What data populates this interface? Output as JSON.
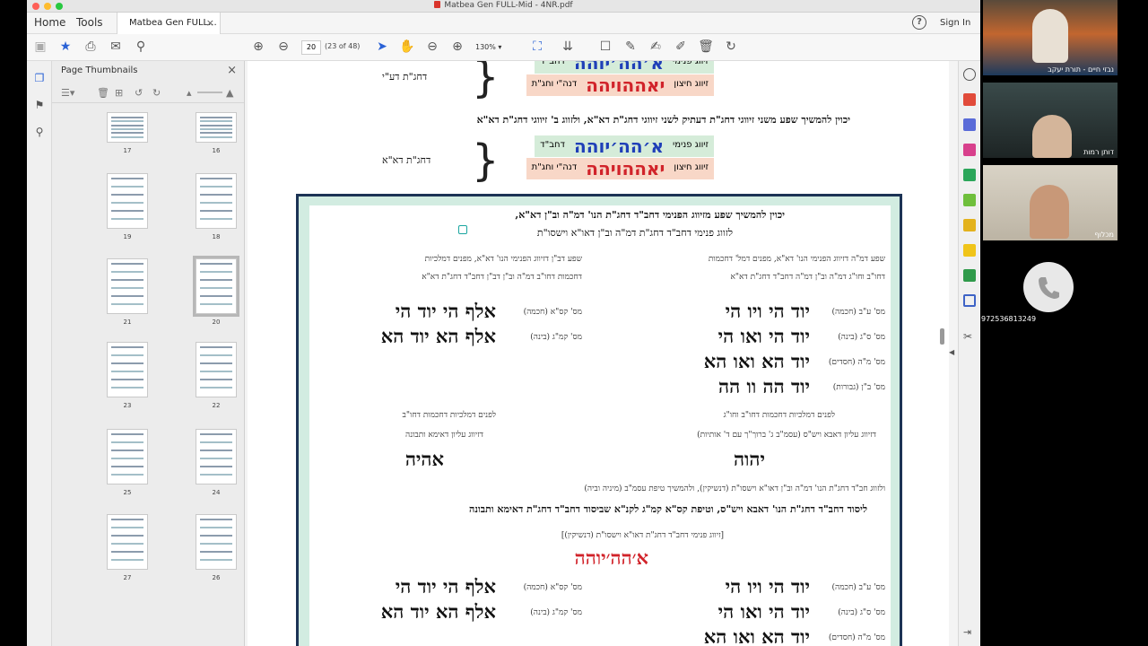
{
  "window": {
    "title": "Matbea Gen FULL-Mid - 4NR.pdf"
  },
  "menu": {
    "home": "Home",
    "tools": "Tools",
    "tab_label": "Matbea Gen FULL...",
    "sign_in": "Sign In",
    "help": "?"
  },
  "toolbar": {
    "page_number": "20",
    "page_of": "(23 of 48)",
    "zoom": "130%"
  },
  "thumbnails": {
    "title": "Page Thumbnails",
    "pages": [
      {
        "label": "17"
      },
      {
        "label": "16"
      },
      {
        "label": "19"
      },
      {
        "label": "18"
      },
      {
        "label": "21"
      },
      {
        "label": "20"
      },
      {
        "label": "23"
      },
      {
        "label": "22"
      },
      {
        "label": "25"
      },
      {
        "label": "24"
      },
      {
        "label": "27"
      },
      {
        "label": "26"
      }
    ]
  },
  "document": {
    "top_table_1": {
      "brace_label": "דחג\"ת דע\"י",
      "rows": [
        {
          "label": "זיווג פנימי",
          "sub": "דחב\"ד",
          "name": "א׳הה׳יוהה"
        },
        {
          "label": "זיווג חיצון",
          "sub": "דנה\"י וחג\"ת",
          "name": "יאההויהה"
        }
      ]
    },
    "sentence_1": "יכוין להמשיך שפע משני זיווגי דחג\"ת דעתיק לשני זיווגי דחג\"ת דא\"א, ולזווג ב' זיווגי דחג\"ת דא\"א",
    "top_table_2": {
      "brace_label": "דחג\"ת דא\"א",
      "rows": [
        {
          "label": "זיווג פנימי",
          "sub": "דחב\"ד",
          "name": "א׳הה׳יוהה"
        },
        {
          "label": "זיווג חיצון",
          "sub": "דנה\"י וחג\"ת",
          "name": "יאההויהה"
        }
      ]
    },
    "box": {
      "intro_1": "יכוין להמשיך שפע מזיווג הפנימי דחב\"ד דחג\"ת הנו' דמ\"ה וב\"ן דא\"א,",
      "intro_2": "לזווג פנימי דחב\"ד דחג\"ת דמ\"ה וב\"ן דאו\"א וישסו\"ת",
      "right_head_1": "שפע דמ\"ה דזיווג הפנימי הנו' דא\"א, מפנים דמל' דחכמות",
      "right_head_2": "דחו\"ב וחו\"ג דמ\"ה וב\"ן דמ\"ה דחב\"ד דחג\"ת דא\"א",
      "left_head_1": "שפע דב\"ן דזיווג הפנימי הנו' דא\"א, מפנים דמלכיות",
      "left_head_2": "דחכמות דחו\"ב דמ\"ה וב\"ן דב\"ן דחב\"ד דחג\"ת דא\"א",
      "right_list": [
        {
          "tag": "מס' ע\"ב (חכמה)",
          "name": "יוד הי ויו הי"
        },
        {
          "tag": "מס' ס\"ג (בינה)",
          "name": "יוד הי ואו הי"
        },
        {
          "tag": "מס' מ\"ה (חסדים)",
          "name": "יוד הא ואו הא"
        },
        {
          "tag": "מס' ב\"ן (גבורות)",
          "name": "יוד הה וו הה"
        }
      ],
      "left_list": [
        {
          "tag": "מס' קס\"א (חכמה)",
          "name": "אלף הי יוד הי"
        },
        {
          "tag": "מס' קמ\"ג (בינה)",
          "name": "אלף הא יוד הא"
        }
      ],
      "mid_right_1": "לפנים דמלכיות דחכמות דחו\"ב וחו\"ג",
      "mid_right_2": "דזיווג עליון דאבא ויש\"ס (עסמ\"ב ג' ברוך\"ך עם ד' אותיות)",
      "mid_right_name": "יהוה",
      "mid_left_1": "לפנים דמלכיות דחכמות דחו\"ב",
      "mid_left_2": "דזיווג עליון דאימא ותבונה",
      "mid_left_name": "אהיה",
      "line_a": "ולזווג חב\"ד דחג\"ת הנו' דמ\"ה וב\"ן דאו\"א וישסו\"ת (דנשיקין), ולהמשיך טיפת עסמ\"ב (מיניה וביה)",
      "line_b": "ליסוד דחב\"ד דחג\"ת הנו' דאבא ויש\"ס, וטיפת קס\"א קמ\"ג לקנ\"א שביסוד דחב\"ד דחג\"ת דאימא ותבונה",
      "bracket_line": "[זיווג פנימי דחב\"ד דחג\"ת דאו\"א וישסו\"ת (דנשיקין)]",
      "center_name": "א׳הה׳יוהה",
      "right_list_2": [
        {
          "tag": "מס' ע\"ב (חכמה)",
          "name": "יוד הי ויו הי"
        },
        {
          "tag": "מס' ס\"ג (בינה)",
          "name": "יוד הי ואו הי"
        },
        {
          "tag": "מס' מ\"ה (חסדים)",
          "name": "יוד הא ואו הא"
        }
      ],
      "left_list_2": [
        {
          "tag": "מס' קס\"א (חכמה)",
          "name": "אלף הי יוד הי"
        },
        {
          "tag": "מס' קמ\"ג (בינה)",
          "name": "אלף הא יוד הא"
        }
      ]
    }
  },
  "participants": [
    {
      "name": "נבזי חיים - תורת יעקב"
    },
    {
      "name": "דותן רמות"
    },
    {
      "name": "מכלוף"
    },
    {
      "name": "972536813249"
    }
  ],
  "colors": {
    "brand_red": "#d9342b",
    "box_border": "#1c3355",
    "box_fill": "#d2ece1",
    "name_blue": "#1f3fb8",
    "name_red": "#d1232a",
    "cell_green": "#d5ecd9",
    "cell_peach": "#f8d7c7"
  }
}
